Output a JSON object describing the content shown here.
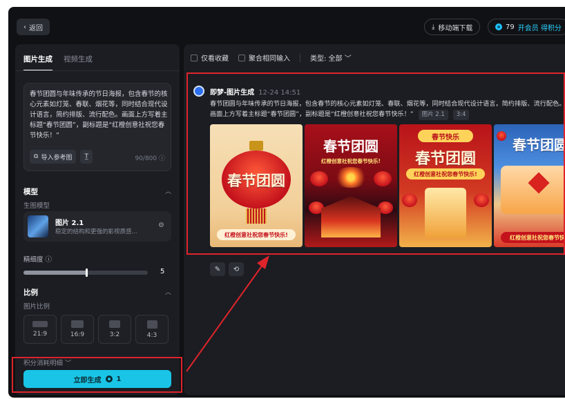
{
  "topbar": {
    "back_label": "返回",
    "download_label": "移动端下载",
    "credits": "79",
    "vip_label": "开会员 得积分"
  },
  "left": {
    "tabs": [
      {
        "label": "图片生成",
        "active": true
      },
      {
        "label": "视频生成",
        "active": false
      }
    ],
    "prompt": "春节团圆与年味传承的节日海报，包含春节的核心元素如灯笼、春联、烟花等，同时结合现代设计语言，简约排版、流行配色。画面上方写着主标题“春节团圆”，副标题是“红橙创意社祝您春节快乐！”",
    "ref_image_label": "导入参考图",
    "text_tool_icon": "text-format-icon",
    "counter": "90/800 ⓘ",
    "model_section": "模型",
    "model_sub": "生图模型",
    "model_name": "图片 2.1",
    "model_desc": "稳定的结构和更强的影视质感...",
    "detail_label": "精细度 ⓘ",
    "detail_value": "5",
    "detail_fraction": 0.5,
    "ratio_section": "比例",
    "ratio_sub": "图片比例",
    "ratios": [
      "21:9",
      "16:9",
      "3:2",
      "4:3"
    ],
    "cost_label": "积分消耗明细 ﹀",
    "generate_label": "立即生成",
    "generate_cost": "1"
  },
  "right": {
    "filter_favorites": "仅看收藏",
    "filter_aggregate": "聚合相同输入",
    "filter_type": "类型: 全部 ﹀",
    "record": {
      "title": "即梦-图片生成",
      "time": "12-24  14:51",
      "prompt": "春节团圆与年味传承的节日海报，包含春节的核心元素如灯笼、春联、烟花等，同时结合现代设计语言，简约排版、流行配色。画面上方写着主标题“春节团圆”，副标题是“红橙创意社祝您春节快乐！”",
      "tag_model": "图片 2.1",
      "tag_ratio": "3:4",
      "posters": [
        {
          "title": "春节团圆",
          "subtitle": "红橙创意社祝您春节快乐!"
        },
        {
          "title": "春节团圆",
          "subtitle": "红橙创意社祝您春节快乐!"
        },
        {
          "title": "春节团圆",
          "top_label": "春节快乐",
          "subtitle": "红橙创意社祝您春节快乐!"
        },
        {
          "title": "春节团圆",
          "subtitle": "红橙创意社祝您春节快乐"
        }
      ]
    }
  },
  "colors": {
    "accent": "#19c4e6",
    "annotation": "#e0242b",
    "background": "#101114",
    "panel": "#1b1d22"
  }
}
